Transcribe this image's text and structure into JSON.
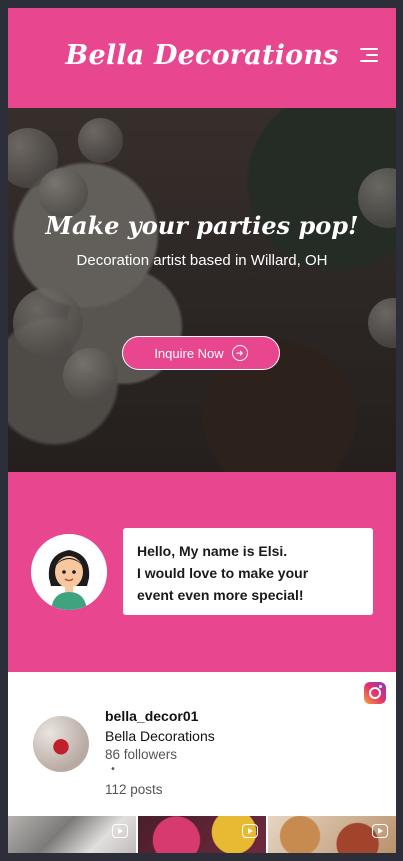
{
  "header": {
    "brand": "Bella Decorations",
    "menu_icon": "hamburger-menu-icon"
  },
  "hero": {
    "title": "Make your parties pop!",
    "subtitle": "Decoration artist based in Willard, OH",
    "cta_label": "Inquire Now",
    "cta_icon": "arrow-right-circle-icon"
  },
  "intro": {
    "avatar_icon": "cartoon-girl-avatar",
    "lines": [
      "Hello, My name is Elsi.",
      "I would love to make your",
      "event even more special!"
    ]
  },
  "instagram": {
    "logo_icon": "instagram-icon",
    "username": "bella_decor01",
    "display_name": "Bella Decorations",
    "followers": "86 followers",
    "separator": "•",
    "posts": "112 posts",
    "thumbnails": [
      {
        "type": "reel",
        "icon": "reel-icon"
      },
      {
        "type": "reel",
        "icon": "reel-icon"
      },
      {
        "type": "reel",
        "icon": "reel-icon"
      }
    ]
  },
  "colors": {
    "brand_pink": "#e8468f",
    "page_bg": "#2c2f3a",
    "white": "#ffffff"
  }
}
